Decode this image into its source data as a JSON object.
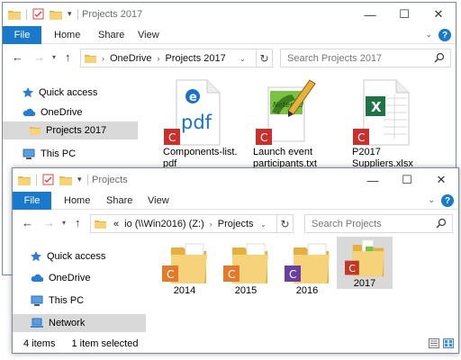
{
  "window_back": {
    "title": "Projects 2017",
    "ribbon": {
      "file": "File",
      "home": "Home",
      "share": "Share",
      "view": "View"
    },
    "address": {
      "crumbs": [
        "OneDrive",
        "Projects 2017"
      ]
    },
    "search": {
      "placeholder": "Search Projects 2017"
    },
    "sidebar": {
      "items": [
        {
          "label": "Quick access",
          "icon": "star-icon"
        },
        {
          "label": "OneDrive",
          "icon": "onedrive-cloud-icon"
        },
        {
          "label": "Projects 2017",
          "icon": "folder-icon",
          "selected": true
        },
        {
          "label": "This PC",
          "icon": "computer-icon"
        }
      ]
    },
    "files": [
      {
        "name_line1": "Components-list.",
        "name_line2": "pdf",
        "icon": "pdf-file-icon",
        "badge": "C"
      },
      {
        "name_line1": "Launch event",
        "name_line2": "participants.txt",
        "icon": "notepad-file-icon",
        "badge": "C"
      },
      {
        "name_line1": "P2017",
        "name_line2": "Suppliers.xlsx",
        "icon": "excel-file-icon",
        "badge": "C"
      }
    ],
    "pdf_icon_text": "pdf",
    "excel_icon_text": "X"
  },
  "window_front": {
    "title": "Projects",
    "ribbon": {
      "file": "File",
      "home": "Home",
      "share": "Share",
      "view": "View"
    },
    "address": {
      "overflow": "«",
      "crumbs": [
        "io (\\\\Win2016) (Z:)",
        "Projects"
      ]
    },
    "search": {
      "placeholder": "Search Projects"
    },
    "sidebar": {
      "items": [
        {
          "label": "Quick access",
          "icon": "star-icon"
        },
        {
          "label": "OneDrive",
          "icon": "onedrive-cloud-icon"
        },
        {
          "label": "This PC",
          "icon": "computer-icon"
        },
        {
          "label": "Network",
          "icon": "network-icon",
          "selected": true
        }
      ]
    },
    "folders": [
      {
        "name": "2014",
        "badge": "C",
        "badge_color": "#e27a2e"
      },
      {
        "name": "2015",
        "badge": "C",
        "badge_color": "#e27a2e"
      },
      {
        "name": "2016",
        "badge": "C",
        "badge_color": "#6b3fa0"
      },
      {
        "name": "2017",
        "badge": "C",
        "badge_color": "#c0392b",
        "selected": true
      }
    ],
    "status": {
      "count": "4 items",
      "selected": "1 item selected"
    }
  },
  "colors": {
    "accent": "#1979ca",
    "folder_yellow": "#f3cf6a",
    "badge_red": "#c9302c",
    "selection": "#d9d9d9"
  }
}
